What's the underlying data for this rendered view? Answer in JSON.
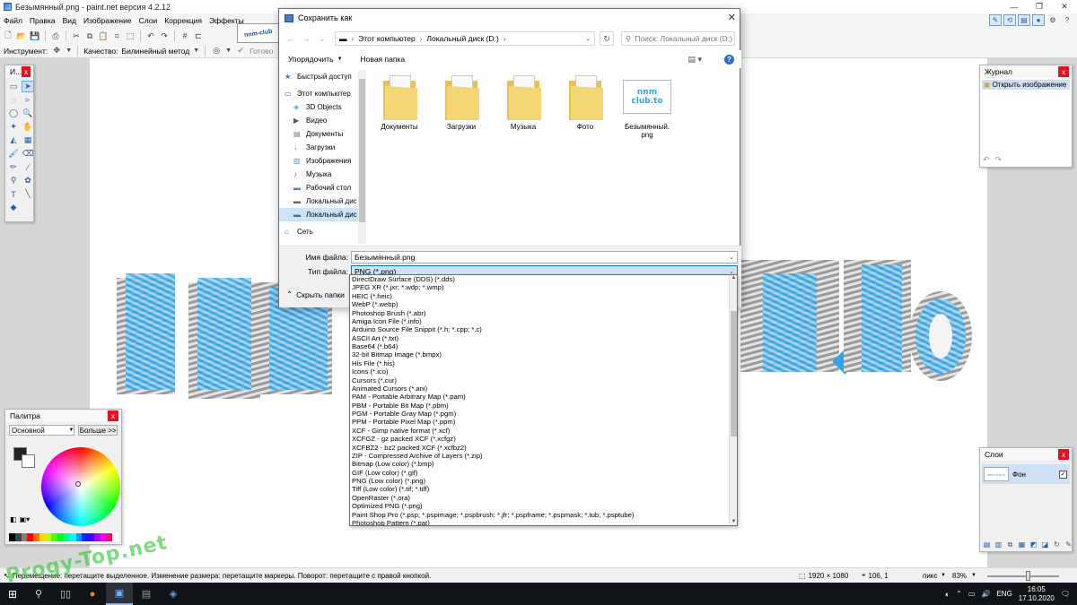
{
  "window": {
    "title": "Безымянный.png - paint.net версия 4.2.12",
    "controls": [
      "—",
      "❐",
      "✕"
    ]
  },
  "menu": [
    "Файл",
    "Правка",
    "Вид",
    "Изображение",
    "Слои",
    "Коррекция",
    "Эффекты"
  ],
  "toolbar2": {
    "tool_label": "Инструмент:",
    "quality_label": "Качество:",
    "quality_value": "Билинейный метод",
    "done_label": "Готово"
  },
  "tools_window": {
    "title": "И..."
  },
  "history_window": {
    "title": "Журнал",
    "items": [
      "Открыть изображение"
    ]
  },
  "palette_window": {
    "title": "Палитра",
    "mode_value": "Основной",
    "more_button": "Больше >>",
    "colors": [
      "#000000",
      "#404040",
      "#808080",
      "#ff0000",
      "#ff6a00",
      "#ffd800",
      "#b6ff00",
      "#4cff00",
      "#00ff21",
      "#00ff90",
      "#00ffff",
      "#0094ff",
      "#0026ff",
      "#4800ff",
      "#b200ff",
      "#ff00dc",
      "#ff006e",
      "#ffffff"
    ]
  },
  "layers_window": {
    "title": "Слои",
    "layers": [
      {
        "name": "Фон",
        "thumb_text": "nnm-club.to"
      }
    ]
  },
  "status": {
    "hint": "Перемещение: перетащите выделенное. Изменение размера: перетащите маркеры. Поворот: перетащите с правой кнопкой.",
    "image_size": "1920 × 1080",
    "cursor_pos": "106, 1",
    "units": "пикс",
    "zoom": "83%"
  },
  "taskbar": {
    "lang": "ENG",
    "time": "16:05",
    "date": "17.10.2020"
  },
  "dialog": {
    "title": "Сохранить как",
    "address": [
      "Этот компьютер",
      "Локальный диск (D:)"
    ],
    "search_placeholder": "Поиск: Локальный диск (D:)",
    "organize_label": "Упорядочить",
    "new_folder_label": "Новая папка",
    "nav": [
      {
        "label": "Быстрый доступ",
        "icon": "star-icon",
        "top": true
      },
      {
        "label": "Этот компьютер",
        "icon": "computer-icon",
        "top": true
      },
      {
        "label": "3D Objects",
        "icon": "3d-objects-icon"
      },
      {
        "label": "Видео",
        "icon": "video-icon"
      },
      {
        "label": "Документы",
        "icon": "documents-icon"
      },
      {
        "label": "Загрузки",
        "icon": "downloads-icon"
      },
      {
        "label": "Изображения",
        "icon": "pictures-icon"
      },
      {
        "label": "Музыка",
        "icon": "music-icon"
      },
      {
        "label": "Рабочий стол",
        "icon": "desktop-icon"
      },
      {
        "label": "Локальный дис",
        "icon": "drive-icon"
      },
      {
        "label": "Локальный дис",
        "icon": "drive-icon",
        "selected": true
      },
      {
        "label": "Сеть",
        "icon": "network-icon",
        "top": true
      }
    ],
    "files": [
      {
        "name": "Документы",
        "kind": "folder"
      },
      {
        "name": "Загрузки",
        "kind": "folder"
      },
      {
        "name": "Музыка",
        "kind": "folder"
      },
      {
        "name": "Фото",
        "kind": "folder"
      },
      {
        "name": "Безымянный.png",
        "kind": "image",
        "thumb_text": "nnm club.to"
      }
    ],
    "filename_label": "Имя файла:",
    "filename_value": "Безымянный.png",
    "filetype_label": "Тип файла:",
    "filetype_value": "PNG (*.png)",
    "hide_folders_label": "Скрыть папки"
  },
  "filetypes": [
    "DirectDraw Surface (DDS) (*.dds)",
    "JPEG XR (*.jxr; *.wdp; *.wmp)",
    "HEIC (*.heic)",
    "WebP (*.webp)",
    "Photoshop Brush (*.abr)",
    "Amiga Icon File (*.info)",
    "Arduino Source File Snippit (*.h; *.cpp; *.c)",
    "ASCII Art (*.txt)",
    "Base64 (*.b64)",
    "32-bit Bitmap Image (*.bmpx)",
    "His File (*.his)",
    "Icons (*.ico)",
    "Cursors (*.cur)",
    "Animated Cursors (*.ani)",
    "PAM - Portable Arbitrary Map (*.pam)",
    "PBM - Portable Bit Map (*.pbm)",
    "PGM - Portable Gray Map (*.pgm)",
    "PPM - Portable Pixel Map (*.ppm)",
    "XCF - Gimp native format (*.xcf)",
    "XCFGZ - gz packed XCF (*.xcfgz)",
    "XCFBZ2 - bz2 packed XCF (*.xcfbz2)",
    "ZIP - Compressed Archive of Layers (*.zip)",
    "Bitmap (Low color) (*.bmp)",
    "GIF (Low color) (*.gif)",
    "PNG (Low color) (*.png)",
    "Tiff (Low color) (*.tif; *.tiff)",
    "OpenRaster (*.ora)",
    "Optimized PNG (*.png)",
    "Paint Shop Pro (*.psp; *.pspimage; *.pspbrush; *.jfr; *.pspframe; *.pspmask; *.tub; *.psptube)",
    "Photoshop Pattern (*.pat)"
  ],
  "watermark": "Progy-Top.net",
  "colors": {
    "accent": "#0078d7",
    "selection": "#cce4f7",
    "art_blue": "#2fa4e7",
    "art_gray": "#d9d9d9"
  }
}
